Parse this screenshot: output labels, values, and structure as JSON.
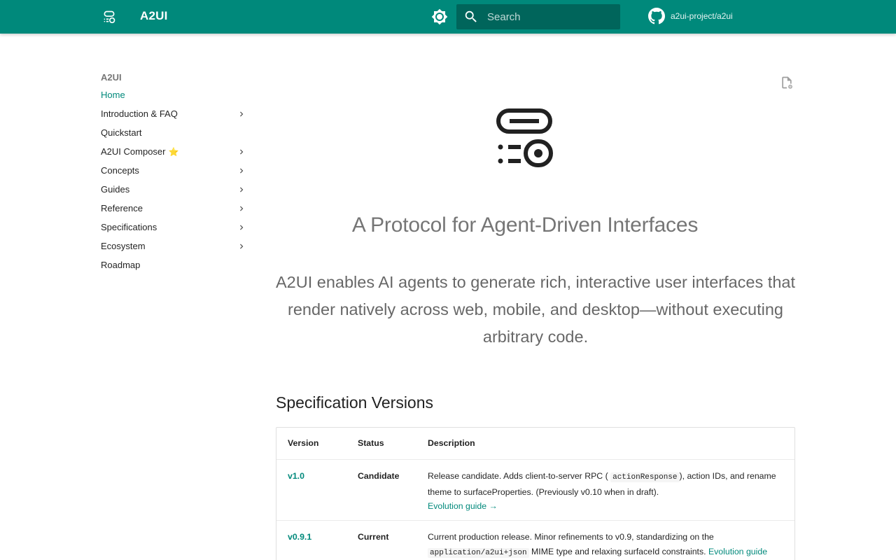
{
  "header": {
    "site_title": "A2UI",
    "search_placeholder": "Search",
    "repo_name": "a2ui-project/a2ui"
  },
  "sidebar": {
    "title": "A2UI",
    "items": [
      {
        "label": "Home",
        "active": true,
        "expandable": false
      },
      {
        "label": "Introduction & FAQ",
        "expandable": true
      },
      {
        "label": "Quickstart",
        "expandable": false
      },
      {
        "label": "A2UI Composer",
        "badge": "⭐",
        "expandable": true
      },
      {
        "label": "Concepts",
        "expandable": true
      },
      {
        "label": "Guides",
        "expandable": true
      },
      {
        "label": "Reference",
        "expandable": true
      },
      {
        "label": "Specifications",
        "expandable": true
      },
      {
        "label": "Ecosystem",
        "expandable": true
      },
      {
        "label": "Roadmap",
        "expandable": false
      }
    ]
  },
  "hero": {
    "title": "A Protocol for Agent-Driven Interfaces",
    "subtitle": "A2UI enables AI agents to generate rich, interactive user interfaces that render natively across web, mobile, and desktop—without executing arbitrary code."
  },
  "spec_section": {
    "title": "Specification Versions",
    "columns": [
      "Version",
      "Status",
      "Description"
    ],
    "rows": [
      {
        "version": "v1.0",
        "status": "Candidate",
        "desc_pre": "Release candidate. Adds client-to-server RPC (",
        "desc_code": "actionResponse",
        "desc_post": "), action IDs, and rename theme to surfaceProperties. (Previously v0.10 when in draft).",
        "desc_link": "Evolution guide →"
      },
      {
        "version": "v0.9.1",
        "status": "Current",
        "desc_pre": "Current production release. Minor refinements to v0.9, standardizing on the",
        "desc_code": "application/a2ui+json",
        "desc_post": "MIME type and relaxing surfaceId constraints.",
        "desc_link": "Evolution guide"
      }
    ]
  },
  "colors": {
    "primary": "#00897b",
    "header_text": "#ffffff"
  }
}
